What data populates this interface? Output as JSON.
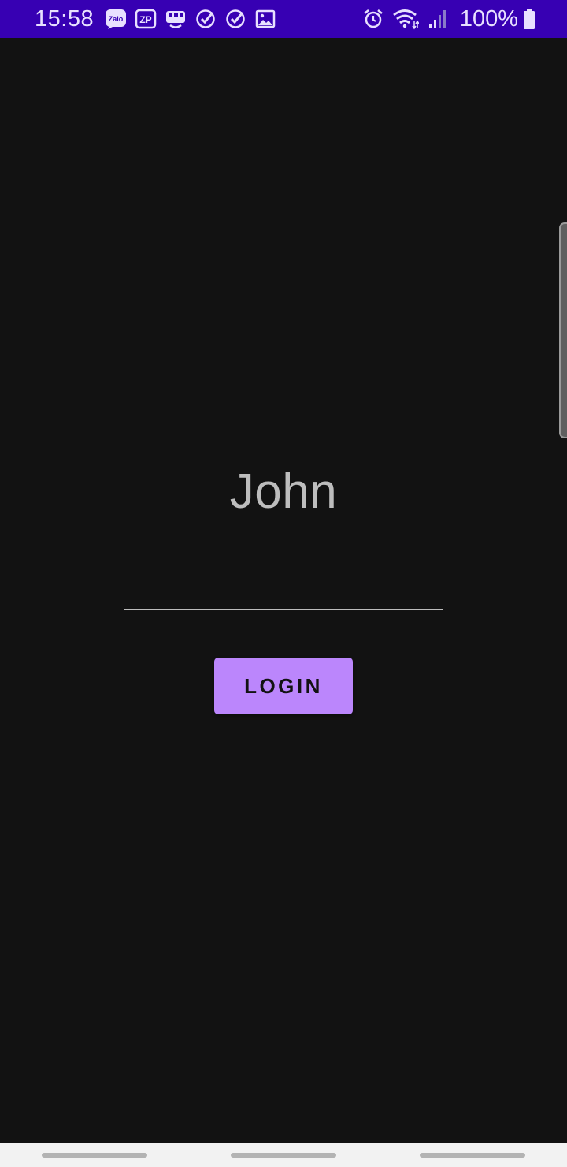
{
  "status_bar": {
    "time": "15:58",
    "notification_icons": [
      "zalo-icon",
      "zalopay-icon",
      "bus-icon",
      "check-circle-icon",
      "check-circle-icon",
      "gallery-icon"
    ],
    "system_icons": [
      "alarm-icon",
      "wifi-icon",
      "signal-icon",
      "battery-icon"
    ],
    "battery": "100%",
    "zalo_label": "Zalo",
    "zalopay_label": "ZP",
    "background_color": "#3700B3"
  },
  "main": {
    "greeting": "John",
    "name_field": {
      "value": "",
      "placeholder": ""
    },
    "login_label": "LOGIN",
    "accent_color": "#BB86FC",
    "background_color": "#121212"
  },
  "nav_bar": {
    "gestures": [
      "recent-apps",
      "home",
      "back"
    ]
  }
}
